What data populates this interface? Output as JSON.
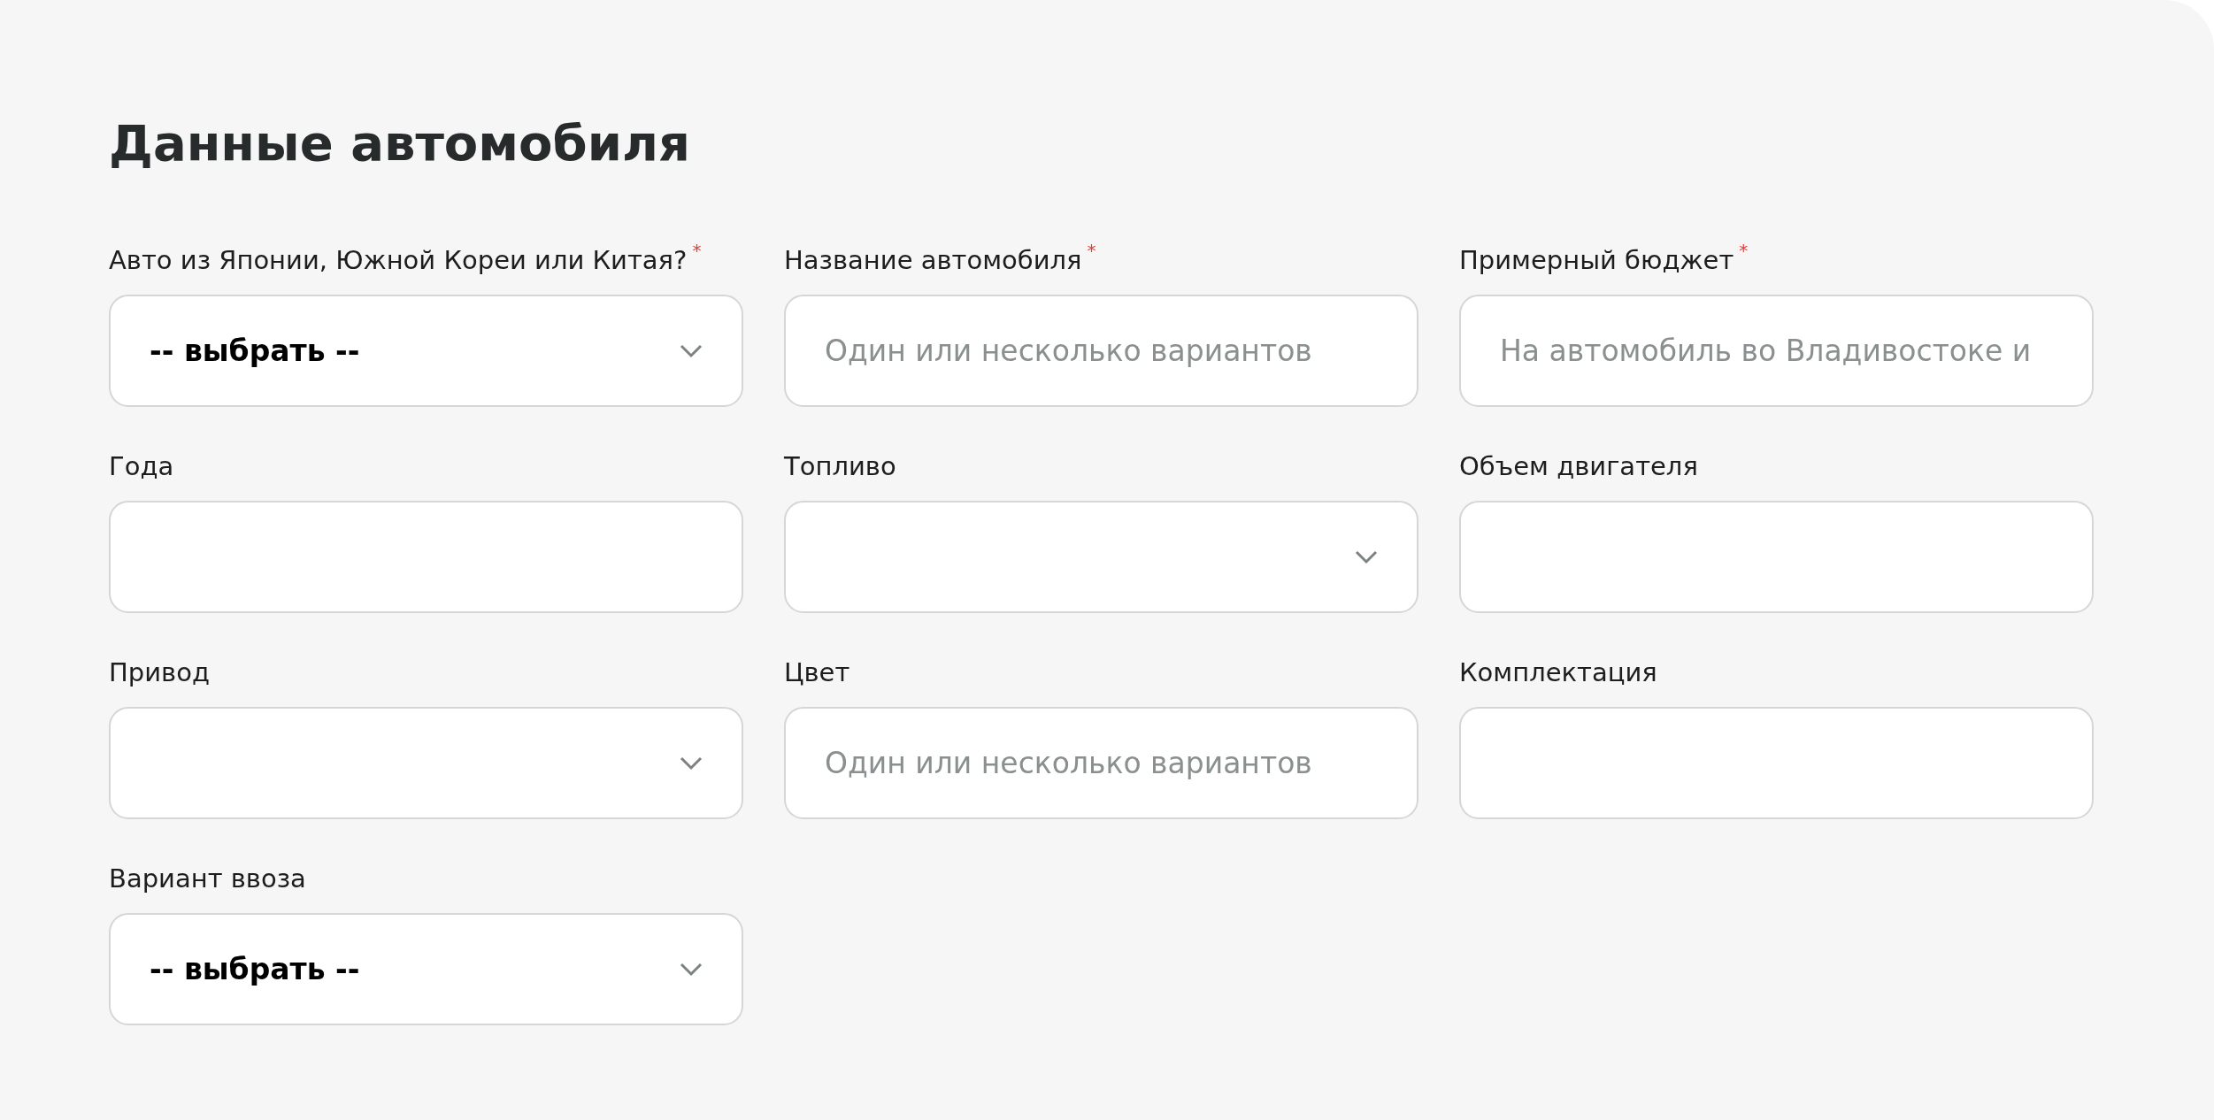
{
  "title": "Данные автомобиля",
  "fields": [
    {
      "kind": "select",
      "label": "Авто из Японии, Южной Кореи или Китая?",
      "required_mark": "*",
      "value": "-- выбрать --"
    },
    {
      "kind": "input",
      "label": "Название автомобиля",
      "required_mark": "*",
      "placeholder": "Один или несколько вариантов"
    },
    {
      "kind": "input",
      "label": "Примерный бюджет",
      "required_mark": "*",
      "placeholder": "На автомобиль во Владивостоке и"
    },
    {
      "kind": "input",
      "label": "Года"
    },
    {
      "kind": "select",
      "label": "Топливо"
    },
    {
      "kind": "input",
      "label": "Объем двигателя"
    },
    {
      "kind": "select",
      "label": "Привод"
    },
    {
      "kind": "input",
      "label": "Цвет",
      "placeholder": "Один или несколько вариантов"
    },
    {
      "kind": "input",
      "label": "Комплектация"
    },
    {
      "kind": "select",
      "label": "Вариант ввоза",
      "value": "-- выбрать --"
    }
  ]
}
